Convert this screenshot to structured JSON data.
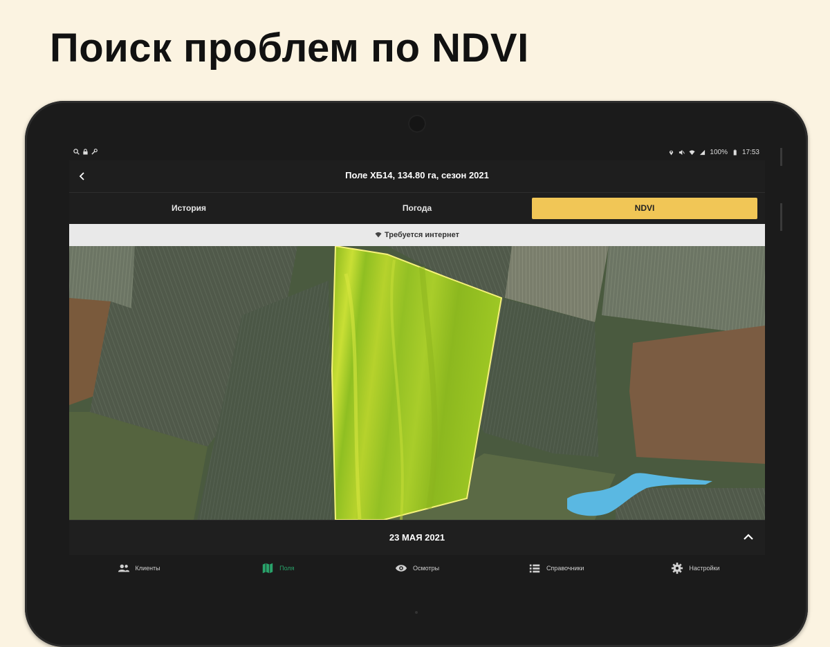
{
  "headline": "Поиск проблем по NDVI",
  "status": {
    "battery": "100%",
    "time": "17:53"
  },
  "appbar": {
    "title": "Поле ХБ14, 134.80 га, сезон 2021"
  },
  "tabs": [
    {
      "label": "История",
      "active": false
    },
    {
      "label": "Погода",
      "active": false
    },
    {
      "label": "NDVI",
      "active": true
    }
  ],
  "notice": {
    "text": "Требуется интернет"
  },
  "datebar": {
    "date": "23 МАЯ 2021"
  },
  "bottom_nav": [
    {
      "label": "Клиенты",
      "icon": "people-icon",
      "active": false
    },
    {
      "label": "Поля",
      "icon": "map-icon",
      "active": true
    },
    {
      "label": "Осмотры",
      "icon": "eye-icon",
      "active": false
    },
    {
      "label": "Справочники",
      "icon": "list-icon",
      "active": false
    },
    {
      "label": "Настройки",
      "icon": "gear-icon",
      "active": false
    }
  ],
  "colors": {
    "background": "#fbf3e1",
    "accent": "#f1c656",
    "active_nav": "#29a26a",
    "ndvi_field": "#a6cf2c",
    "water": "#5ab8e2"
  }
}
